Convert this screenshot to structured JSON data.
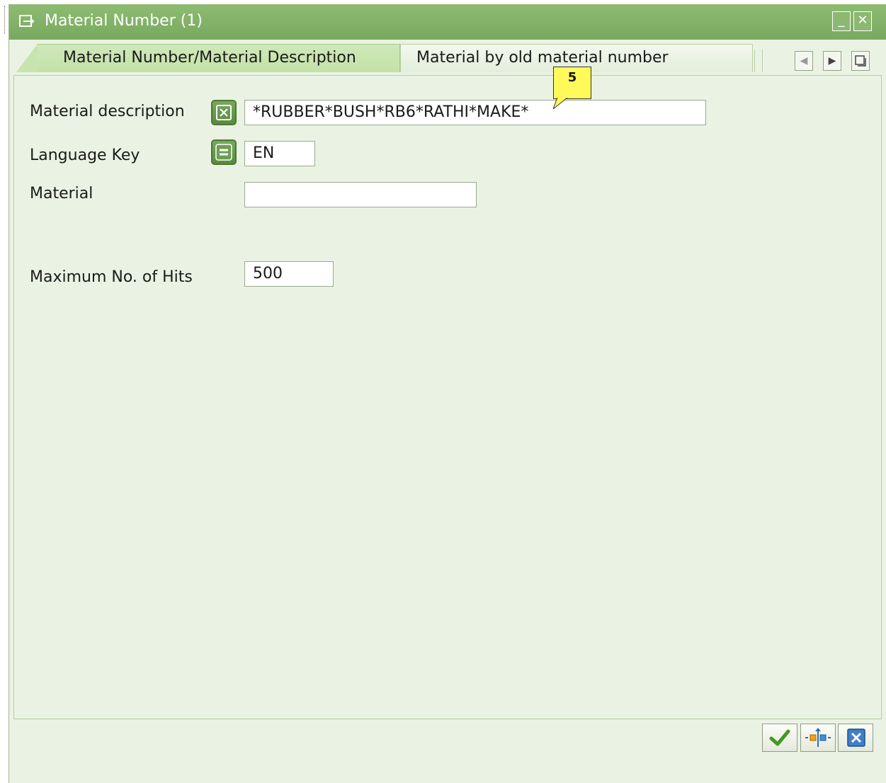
{
  "window": {
    "title": "Material Number (1)",
    "icon": "dialog-icon",
    "buttons": [
      {
        "name": "minimize",
        "glyph": "_"
      },
      {
        "name": "close",
        "glyph": "✕"
      }
    ]
  },
  "tabs": [
    {
      "label": "Material Number/Material Description",
      "active": true
    },
    {
      "label": "Material by old material number",
      "active": false
    }
  ],
  "tab_nav": {
    "left": "◀",
    "right": "▶",
    "list": "list-tabs-icon"
  },
  "form": {
    "material_description": {
      "label": "Material description",
      "value": "*RUBBER*BUSH*RB6*RATHI*MAKE*",
      "option_icon": "select-option-pattern-icon"
    },
    "language_key": {
      "label": "Language Key",
      "value": "EN",
      "option_icon": "select-option-equals-icon"
    },
    "material": {
      "label": "Material",
      "value": ""
    },
    "max_hits": {
      "label": "Maximum No. of Hits",
      "value": "500"
    }
  },
  "callout": {
    "text": "5"
  },
  "footer": {
    "buttons": [
      {
        "name": "continue",
        "icon": "checkmark-icon"
      },
      {
        "name": "multiple-selection",
        "icon": "multiple-selection-icon"
      },
      {
        "name": "cancel",
        "icon": "cancel-x-icon"
      }
    ]
  },
  "colors": {
    "titlebar": "#8dbc72",
    "background": "#eaf3e3",
    "active_tab": "#c8e4ae",
    "callout": "#fff95a",
    "option_button": "#5a8a40"
  }
}
